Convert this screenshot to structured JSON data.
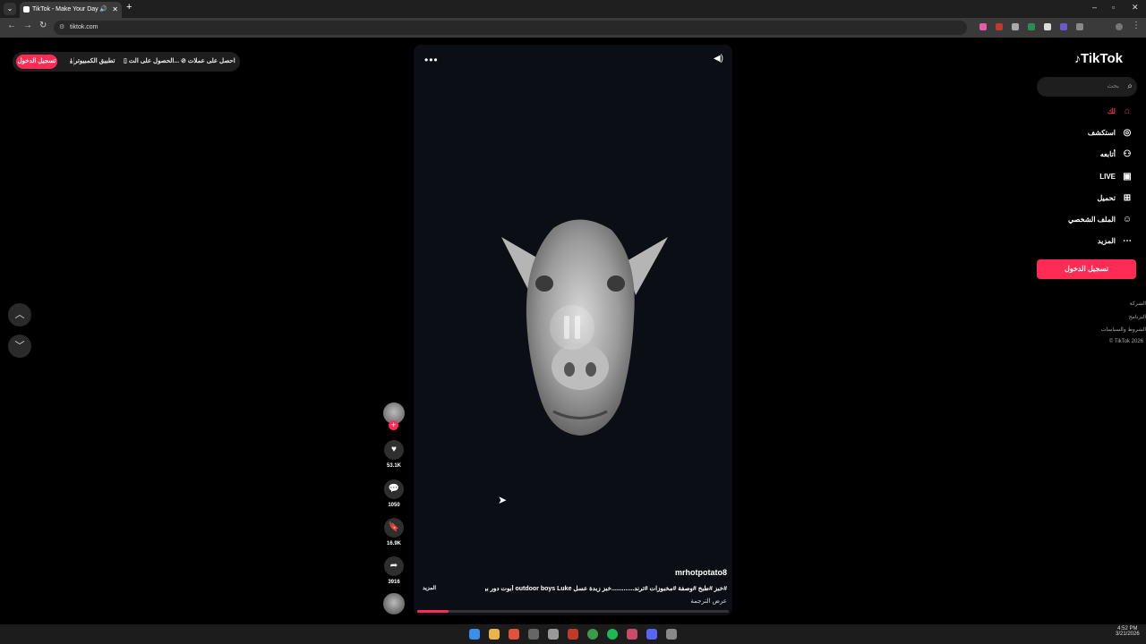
{
  "browser": {
    "tab_title": "TikTok - Make Your Day",
    "url": "tiktok.com"
  },
  "topbar": {
    "login": "تسجيل الدخول",
    "get_app": "تطبيق الكمبيوتر",
    "get_on": "الحصول على الت...",
    "coins": "احصل على عملات"
  },
  "sidebar": {
    "logo": "TikTok",
    "search_placeholder": "بحث",
    "items": [
      {
        "label": "لك",
        "icon": "home-icon",
        "active": true
      },
      {
        "label": "استكشف",
        "icon": "compass-icon"
      },
      {
        "label": "أتابعه",
        "icon": "following-icon"
      },
      {
        "label": "LIVE",
        "icon": "live-icon"
      },
      {
        "label": "تحميل",
        "icon": "upload-icon"
      },
      {
        "label": "الملف الشخصي",
        "icon": "profile-icon"
      },
      {
        "label": "المزيد",
        "icon": "more-icon"
      }
    ],
    "login_button": "تسجيل الدخول",
    "footer": [
      "الشركة",
      "البرنامج",
      "الشروط والسياسات",
      "© TikTok 2026"
    ]
  },
  "video": {
    "username": "mrhotpotato8",
    "caption": "#خبز #طبخ #وصفة #مخبوزات #ترند.............خبز زبدة عسل outdoor boys Luke أبوت دور بويز...",
    "more": "المزيد",
    "translate": "عرض الترجمة",
    "progress_fraction": 0.1
  },
  "actions": {
    "likes": "53.1K",
    "comments": "1050",
    "saves": "16.9K",
    "shares": "3916"
  },
  "taskbar": {
    "time": "4:52 PM",
    "date": "3/21/2026"
  },
  "colors": {
    "accent": "#fe2c55",
    "background": "#000000"
  }
}
